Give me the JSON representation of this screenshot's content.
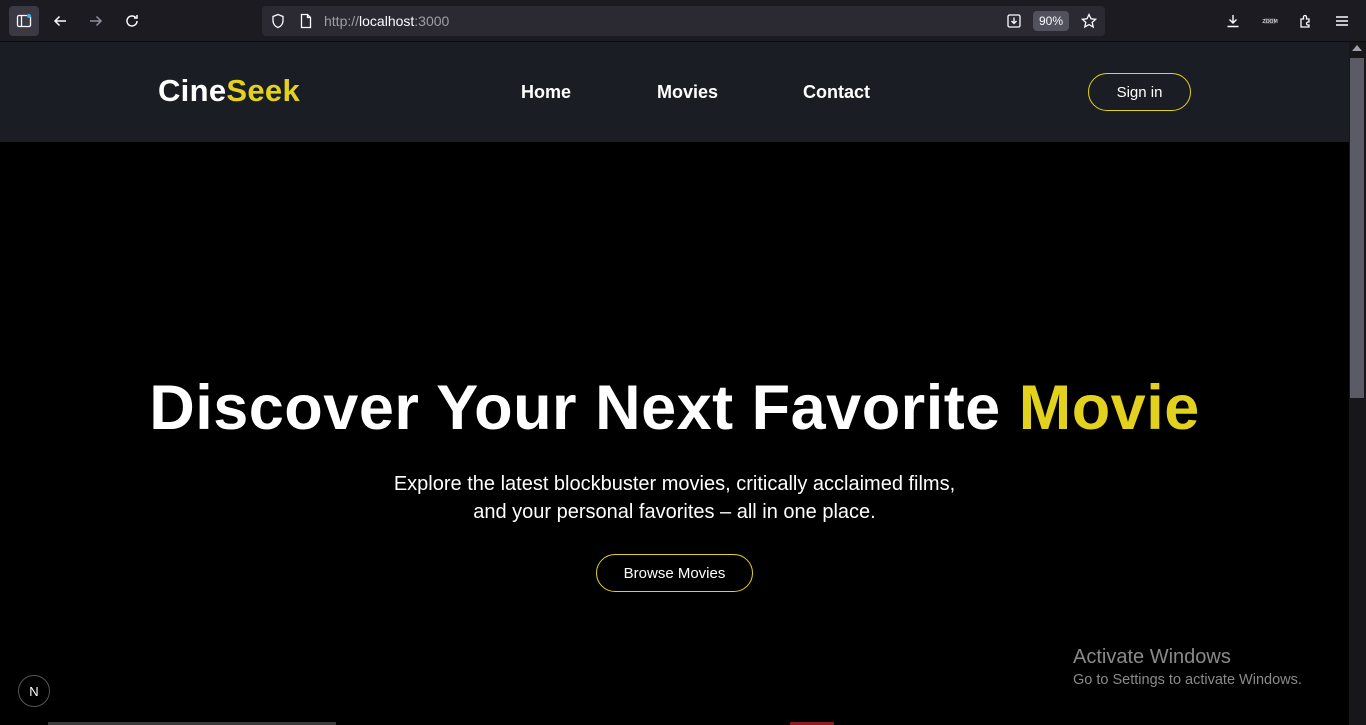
{
  "browser": {
    "url_prefix": "http://",
    "url_host": "localhost",
    "url_suffix": ":3000",
    "zoom": "90%"
  },
  "site": {
    "logo_part1": "Cine",
    "logo_part2": "Seek",
    "nav": [
      {
        "label": "Home"
      },
      {
        "label": "Movies"
      },
      {
        "label": "Contact"
      }
    ],
    "signin_label": "Sign in"
  },
  "hero": {
    "title_main": "Discover Your Next Favorite ",
    "title_accent": "Movie",
    "subtitle": "Explore the latest blockbuster movies, critically acclaimed films, and your personal favorites – all in one place.",
    "cta_label": "Browse Movies"
  },
  "overlay": {
    "next_badge": "N",
    "activate_title": "Activate Windows",
    "activate_sub": "Go to Settings to activate Windows."
  },
  "colors": {
    "accent": "#e2d11d",
    "nav_bg": "#1a1d23",
    "page_bg": "#000000"
  }
}
